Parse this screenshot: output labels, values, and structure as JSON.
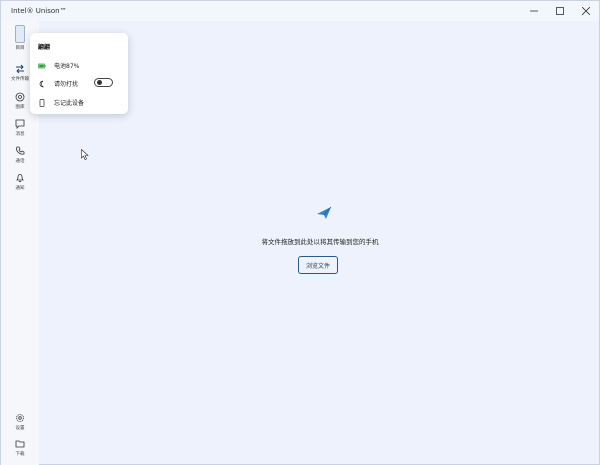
{
  "window": {
    "title": "Intel® Unison™"
  },
  "sidebar": {
    "items": [
      {
        "label": "目目",
        "icon": "phone-thumbnail-icon"
      },
      {
        "label": "文件传输",
        "icon": "transfer-icon"
      },
      {
        "label": "图库",
        "icon": "gallery-icon"
      },
      {
        "label": "消息",
        "icon": "message-icon"
      },
      {
        "label": "通话",
        "icon": "phone-icon"
      },
      {
        "label": "通知",
        "icon": "bell-icon"
      }
    ],
    "bottom_items": [
      {
        "label": "设置",
        "icon": "gear-icon"
      },
      {
        "label": "下载",
        "icon": "folder-icon"
      }
    ]
  },
  "popup": {
    "title": "翩翩",
    "battery_label": "电池87%",
    "dnd_label": "请勿打扰",
    "dnd_enabled": false,
    "forget_label": "忘记此设备"
  },
  "main": {
    "drop_text": "将文件拖放到此处以将其传输到您的手机",
    "browse_label": "浏览文件"
  },
  "colors": {
    "accent": "#2a5a8a",
    "battery": "#2e9e3e",
    "background": "#edf2fc"
  }
}
